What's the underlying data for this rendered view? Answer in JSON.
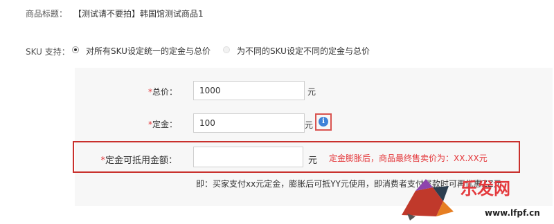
{
  "product": {
    "label": "商品标题：",
    "title": "【测试请不要拍】韩国馆测试商品1"
  },
  "sku": {
    "label": "SKU 支持：",
    "options": [
      {
        "label": "对所有SKU设定统一的定金与总价",
        "selected": true
      },
      {
        "label": "为不同的SKU设定不同的定金与总价",
        "selected": false
      }
    ]
  },
  "form": {
    "total_price": {
      "label": "总价：",
      "star": "*",
      "value": "1000",
      "unit": "元"
    },
    "deposit": {
      "label": "定金：",
      "star": "*",
      "value": "100",
      "unit": "元",
      "icon": "info-icon"
    },
    "deductible": {
      "label": "定金可抵用金额：",
      "star": "*",
      "value": "",
      "unit": "元",
      "hint": "定金膨胀后，商品最终售卖价为：XX.XX元"
    },
    "note": "即：买家支付xx元定金，膨胀后可抵YY元使用，即消费者支付尾款时可再优惠ZZ元"
  },
  "watermark": {
    "brand": "乐发网",
    "url": "www.lfpf.cn"
  },
  "colors": {
    "red": "#e4393c",
    "info_blue": "#3e82d8",
    "panel_bg": "#f7f7f7"
  }
}
